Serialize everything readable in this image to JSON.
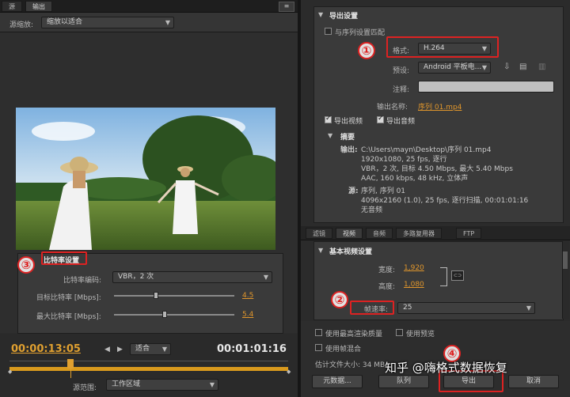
{
  "left": {
    "tabs": [
      {
        "label": "源"
      },
      {
        "label": "输出"
      }
    ],
    "menu_icon": "≡",
    "source_scale_label": "源缩放:",
    "source_scale_value": "缩放以适合",
    "bitrate": {
      "title": "比特率设置",
      "encoding_label": "比特率编码:",
      "encoding_value": "VBR，2 次",
      "target_label": "目标比特率 [Mbps]:",
      "target_value": "4.5",
      "target_level": 0.35,
      "max_label": "最大比特率 [Mbps]:",
      "max_value": "5.4",
      "max_level": 0.42
    },
    "timeline": {
      "current_time": "00:00:13:05",
      "fit_label": "适合",
      "duration": "00:01:01:16",
      "playhead_fraction": 0.22,
      "range_label": "源范围:",
      "range_value": "工作区域"
    }
  },
  "right": {
    "export_settings": {
      "title": "导出设置",
      "match_sequence": "与序列设置匹配",
      "format_label": "格式:",
      "format_value": "H.264",
      "preset_label": "预设:",
      "preset_value": "Android 平板电...",
      "comment_label": "注释:",
      "output_name_label": "输出名称:",
      "output_name_value": "序列 01.mp4",
      "export_video": "导出视频",
      "export_audio": "导出音频"
    },
    "summary": {
      "title": "摘要",
      "output_label": "输出:",
      "output_lines": [
        "C:\\Users\\mayn\\Desktop\\序列 01.mp4",
        "1920x1080, 25 fps, 逐行",
        "VBR，2 次, 目标 4.50 Mbps, 最大 5.40 Mbps",
        "AAC, 160 kbps, 48 kHz, 立体声"
      ],
      "source_label": "源:",
      "source_lines": [
        "序列, 序列 01",
        "4096x2160 (1.0), 25 fps, 逐行扫描, 00:01:01:16",
        "无音频"
      ]
    },
    "tabs": [
      {
        "label": "滤镜"
      },
      {
        "label": "视频"
      },
      {
        "label": "音频"
      },
      {
        "label": "多路复用器"
      },
      {
        "label": "FTP"
      }
    ],
    "video": {
      "section_title": "基本视频设置",
      "width_label": "宽度:",
      "width_value": "1,920",
      "height_label": "高度:",
      "height_value": "1,080",
      "link_icon": "⊂⊃",
      "framerate_label": "帧速率:",
      "framerate_value": "25"
    },
    "bottom": {
      "max_render_quality": "使用最高渲染质量",
      "use_previews": "使用预览",
      "use_frame_blending": "使用帧混合",
      "estimated_size": "估计文件大小: 34 MB",
      "metadata_button": "元数据...",
      "queue_button": "队列",
      "export_button": "导出",
      "cancel_button": "取消"
    }
  },
  "annotations": [
    "①",
    "②",
    "③",
    "④"
  ],
  "watermark": "知乎 @嗨格式数据恢复",
  "colors": {
    "accent": "#e0962c",
    "annotation": "#dd2222",
    "timeline": "#d99a1d"
  }
}
